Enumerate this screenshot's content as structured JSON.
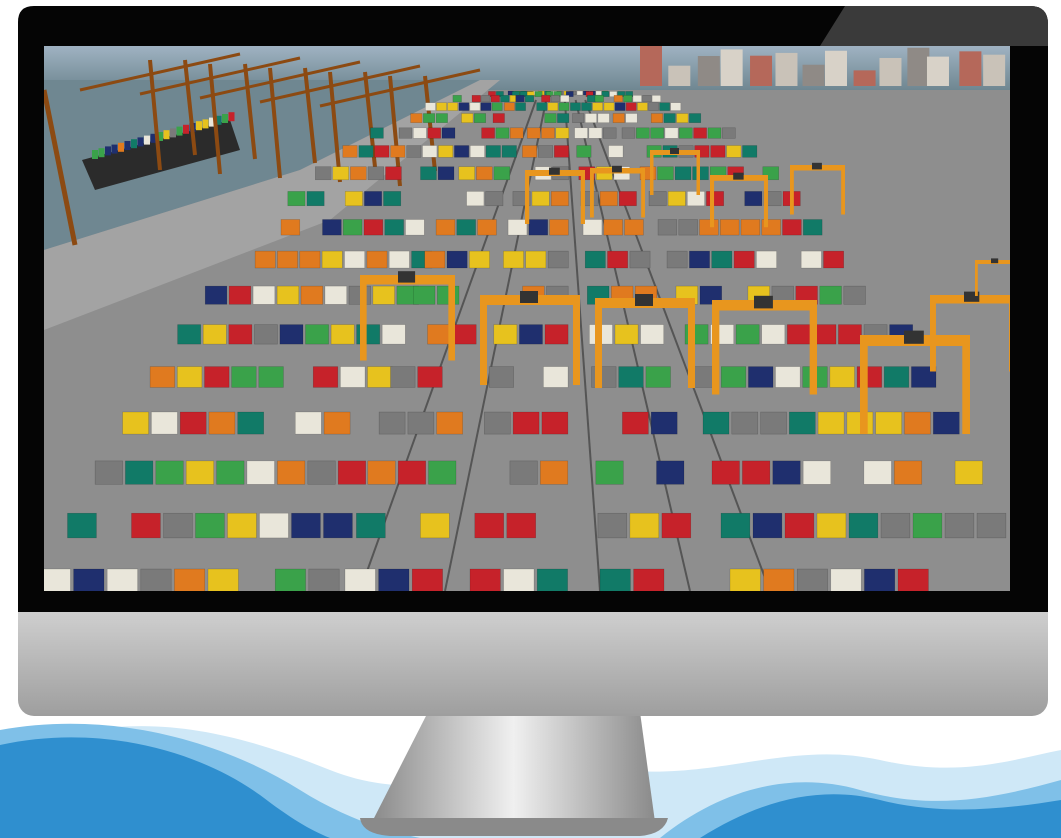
{
  "colors": {
    "background": "#ffffff",
    "bezel": "#050505",
    "bezel_highlight": "#3a3a3a",
    "chin_top": "#d9d9d9",
    "chin_bottom": "#9e9e9e",
    "stand_light": "#f0f0f0",
    "stand_dark": "#8a8a8a",
    "sea": "#6f8791",
    "sky": "#9fb2c2",
    "yard_ground": "#8e8e8e",
    "crane_orange": "#e8961e",
    "quay_crane": "#8c4a12",
    "wave_dark": "#2f8fcf",
    "wave_mid": "#7fc0e8",
    "wave_light": "#cfe8f7",
    "containers": [
      "#c6222a",
      "#117a67",
      "#1f2f6e",
      "#e9e6da",
      "#e7c21e",
      "#7a7a7a",
      "#e07a1f",
      "#3aa24a"
    ]
  },
  "scene": {
    "subject": "container-terminal",
    "gantry_crane_count": 12,
    "quay_crane_count": 5
  }
}
